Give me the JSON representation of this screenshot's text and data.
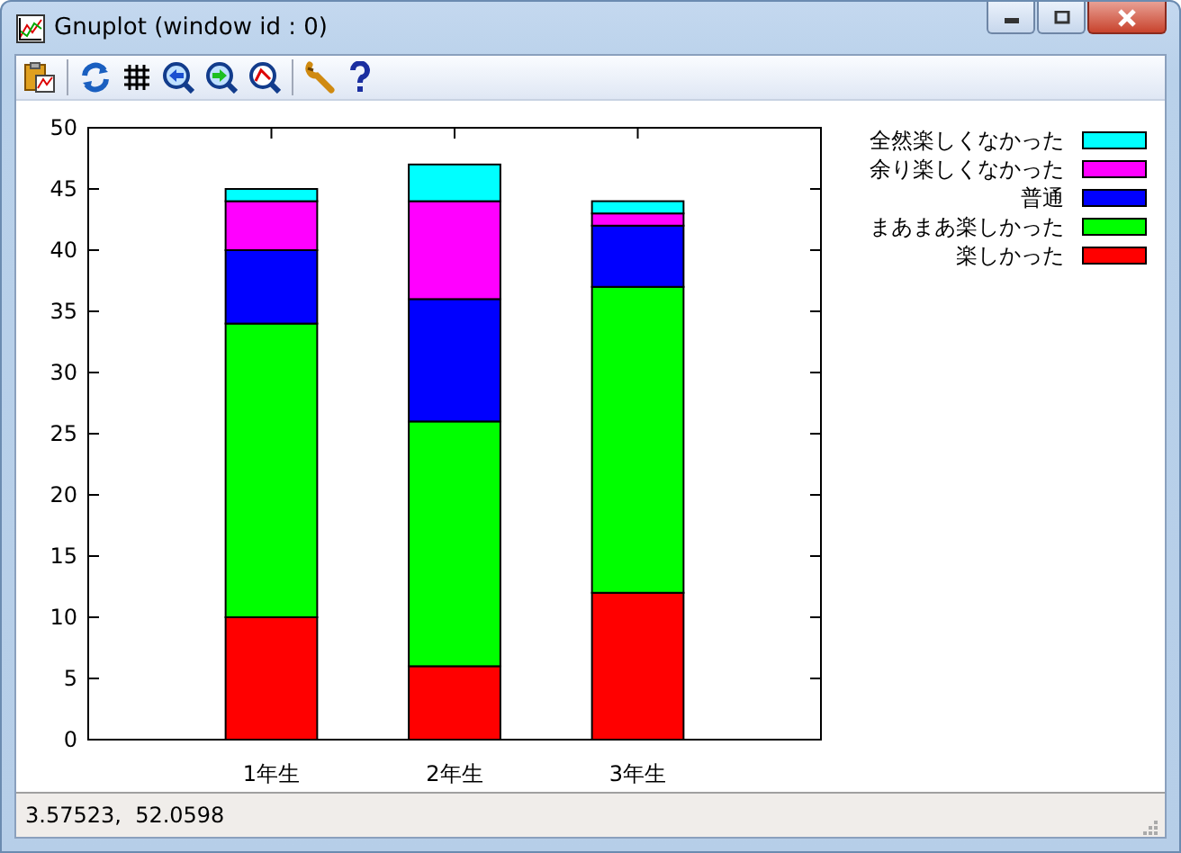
{
  "window": {
    "title": "Gnuplot (window id : 0)"
  },
  "plot": {
    "chart_data": {
      "type": "bar",
      "stacked": true,
      "categories": [
        "1年生",
        "2年生",
        "3年生"
      ],
      "legend": true,
      "ylim": [
        0,
        50
      ],
      "yticks": [
        0,
        5,
        10,
        15,
        20,
        25,
        30,
        35,
        40,
        45,
        50
      ],
      "series": [
        {
          "name": "楽しかった",
          "color": "#ff0000",
          "values": [
            10,
            6,
            12
          ]
        },
        {
          "name": "まあまあ楽しかった",
          "color": "#00ff00",
          "values": [
            24,
            20,
            25
          ]
        },
        {
          "name": "普通",
          "color": "#0000ff",
          "values": [
            6,
            10,
            5
          ]
        },
        {
          "name": "余り楽しくなかった",
          "color": "#ff00ff",
          "values": [
            4,
            8,
            1
          ]
        },
        {
          "name": "全然楽しくなかった",
          "color": "#00ffff",
          "values": [
            1,
            3,
            1
          ]
        }
      ]
    }
  },
  "status_bar": {
    "text": "3.57523,  52.0598"
  }
}
